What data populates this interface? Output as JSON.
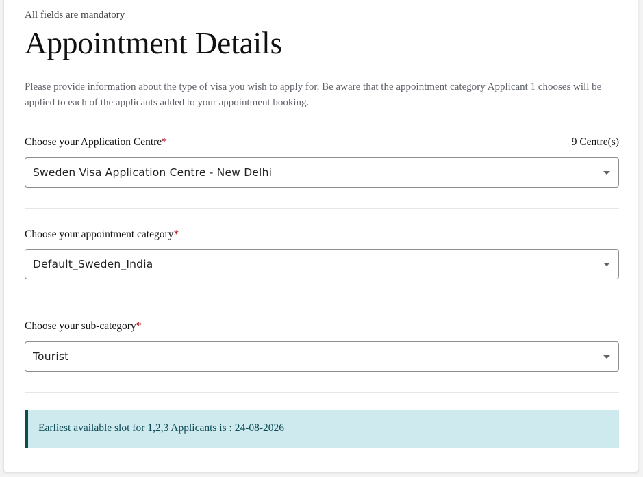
{
  "form": {
    "mandatory_note": "All fields are mandatory",
    "title": "Appointment Details",
    "intro": "Please provide information about the type of visa you wish to apply for. Be aware that the appointment category Applicant 1 chooses will be applied to each of the applicants added to your appointment booking.",
    "required_marker": "*",
    "centre": {
      "label": "Choose your Application Centre",
      "count": "9 Centre(s)",
      "value": "Sweden Visa Application Centre - New Delhi"
    },
    "category": {
      "label": "Choose your appointment category",
      "value": "Default_Sweden_India"
    },
    "subcategory": {
      "label": "Choose your sub-category",
      "value": "Tourist"
    },
    "slot_message": "Earliest available slot for 1,2,3 Applicants is : 24-08-2026"
  },
  "icons": {
    "dropdown": "caret-down-icon"
  },
  "colors": {
    "required": "#b10f1e",
    "alert_background": "#cfeaee",
    "alert_border": "#0d4d4d",
    "alert_text": "#0b4a55"
  }
}
